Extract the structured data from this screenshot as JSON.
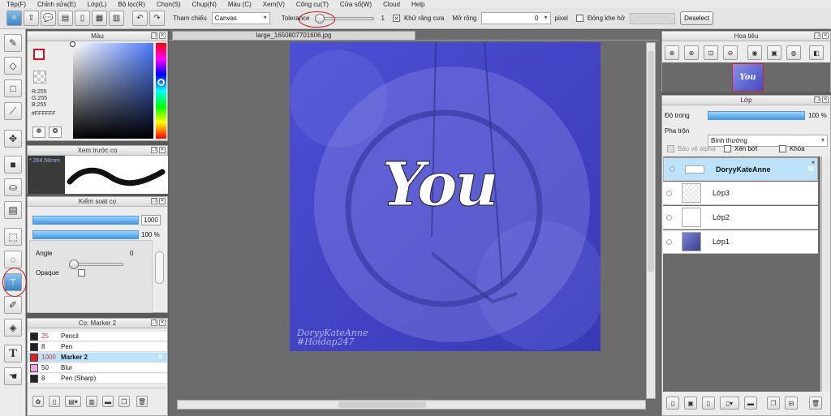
{
  "menu": [
    "Tệp(F)",
    "Chỉnh sửa(E)",
    "Lớp(L)",
    "Bộ lọc(R)",
    "Chọn(S)",
    "Chụp(N)",
    "Màu (C)",
    "Xem(V)",
    "Công cụ(T)",
    "Cửa sổ(W)",
    "Cloud",
    "Help"
  ],
  "toolbar": {
    "ref_label": "Tham chiếu",
    "ref_value": "Canvas",
    "tolerance_label": "Tolerance",
    "tolerance_value": "1",
    "antialias_label": "Khử răng cưa",
    "expand_label": "Mở rộng",
    "expand_value": "0",
    "expand_unit": "pixel",
    "closegap_label": "Đóng khe hở",
    "deselect_label": "Deselect"
  },
  "color_panel": {
    "title": "Màu",
    "r": "R:255",
    "g": "G:255",
    "b": "B:255",
    "hex": "#FFFFFF",
    "current_color": "#e01010"
  },
  "brush_preview": {
    "title": "Xem trước cọ",
    "size": "* 264.58mm"
  },
  "brush_control": {
    "title": "Kiểm soát cọ",
    "size_value": "1000",
    "opacity_value": "100",
    "opacity_unit": "%",
    "angle_label": "Angle",
    "angle_value": "0",
    "opaque_label": "Opaque"
  },
  "brush_list": {
    "title": "Cọ: Marker 2",
    "items": [
      {
        "size": "25",
        "name": "Pencil",
        "color": "#222222"
      },
      {
        "size": "8",
        "name": "Pen",
        "color": "#222222"
      },
      {
        "size": "1000",
        "name": "Marker 2",
        "color": "#e02020",
        "selected": true
      },
      {
        "size": "50",
        "name": "Blur",
        "color": "#e9a6e0"
      },
      {
        "size": "8",
        "name": "Pen (Sharp)",
        "color": "#222222"
      }
    ]
  },
  "canvas": {
    "tab_label": "large_1650807701606.jpg",
    "artwork_text": "You",
    "watermark1": "DoryyKateAnne",
    "watermark2": "#Hoidap247"
  },
  "navigator": {
    "title": "Hoa tiêu"
  },
  "layers": {
    "title": "Lớp",
    "opacity_label": "Độ trong",
    "opacity_value": "100",
    "opacity_unit": "%",
    "blend_label": "Pha trộn",
    "blend_value": "Bình thường",
    "protect_alpha": "Bảo vệ alpha",
    "clip": "Xén bớt",
    "lock": "Khóa",
    "items": [
      {
        "name": "DoryyKateAnne",
        "selected": true
      },
      {
        "name": "Lớp3"
      },
      {
        "name": "Lớp2"
      },
      {
        "name": "Lớp1"
      }
    ]
  }
}
